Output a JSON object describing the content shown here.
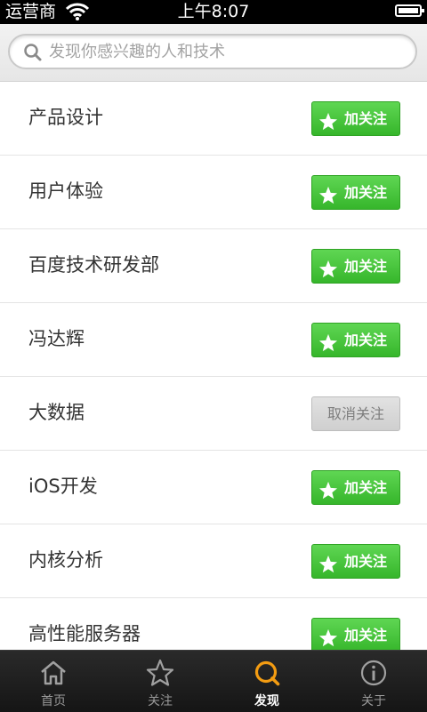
{
  "status_bar": {
    "carrier": "运营商",
    "time": "上午8:07"
  },
  "search": {
    "placeholder": "发现你感兴趣的人和技术"
  },
  "topics": [
    {
      "title": "产品设计",
      "button": "加关注",
      "followed": false
    },
    {
      "title": "用户体验",
      "button": "加关注",
      "followed": false
    },
    {
      "title": "百度技术研发部",
      "button": "加关注",
      "followed": false
    },
    {
      "title": "冯达辉",
      "button": "加关注",
      "followed": false
    },
    {
      "title": "大数据",
      "button": "取消关注",
      "followed": true
    },
    {
      "title": "iOS开发",
      "button": "加关注",
      "followed": false
    },
    {
      "title": "内核分析",
      "button": "加关注",
      "followed": false
    },
    {
      "title": "高性能服务器",
      "button": "加关注",
      "followed": false
    }
  ],
  "tabs": [
    {
      "label": "首页",
      "icon": "home-icon",
      "active": false
    },
    {
      "label": "关注",
      "icon": "star-icon",
      "active": false
    },
    {
      "label": "发现",
      "icon": "discover-icon",
      "active": true
    },
    {
      "label": "关于",
      "icon": "info-icon",
      "active": false
    }
  ],
  "colors": {
    "accent_green": "#3fc233",
    "active_tab": "#f39c12"
  }
}
